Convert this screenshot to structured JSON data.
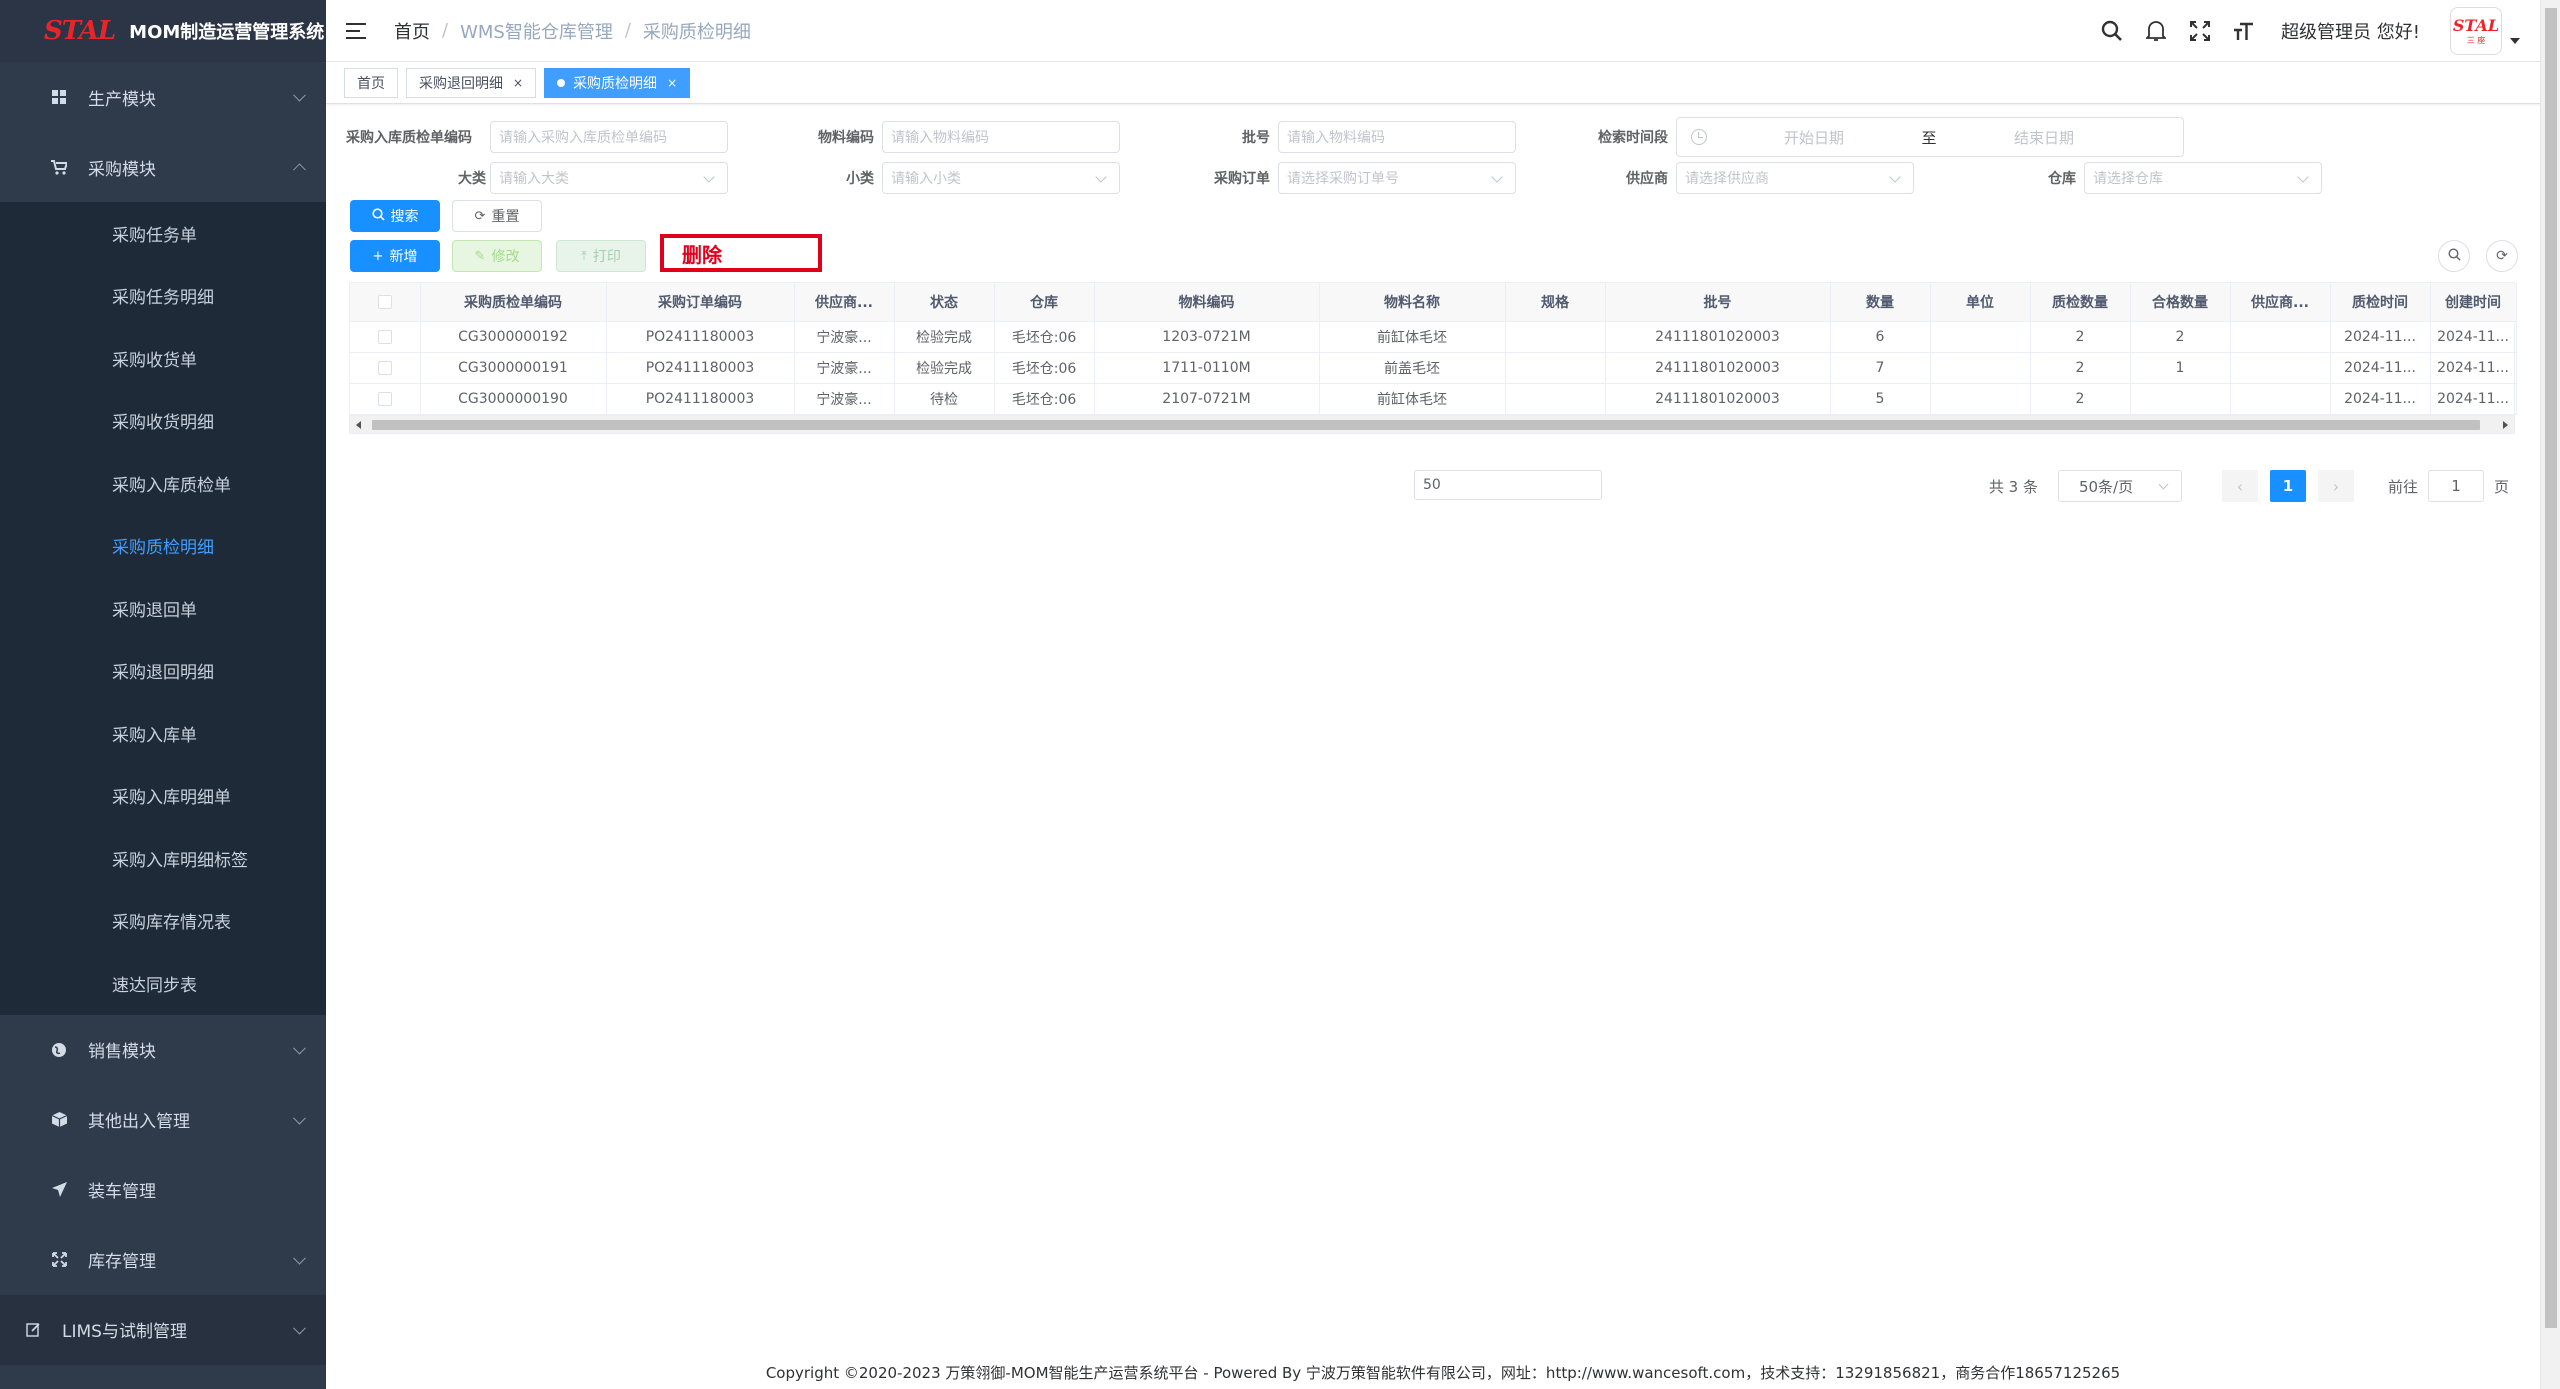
{
  "app": {
    "logo": "STAL",
    "title": "MOM制造运营管理系统"
  },
  "sidebar": {
    "items": [
      {
        "label": "生产模块",
        "icon": "grid-icon"
      },
      {
        "label": "采购模块",
        "icon": "cart-icon"
      },
      {
        "label": "销售模块",
        "icon": "globe-icon"
      },
      {
        "label": "其他出入管理",
        "icon": "box-icon"
      },
      {
        "label": "装车管理",
        "icon": "send-icon"
      },
      {
        "label": "库存管理",
        "icon": "expand-icon"
      },
      {
        "label": "LIMS与试制管理",
        "icon": "edit-icon"
      }
    ],
    "purchase_sub": [
      "采购任务单",
      "采购任务明细",
      "采购收货单",
      "采购收货明细",
      "采购入库质检单",
      "采购质检明细",
      "采购退回单",
      "采购退回明细",
      "采购入库单",
      "采购入库明细单",
      "采购入库明细标签",
      "采购库存情况表",
      "速达同步表"
    ]
  },
  "header": {
    "breadcrumb": [
      "首页",
      "WMS智能仓库管理",
      "采购质检明细"
    ],
    "greeting": "超级管理员 您好!",
    "avatar_top": "STAL",
    "avatar_bottom": "三 座"
  },
  "tags": [
    {
      "label": "首页"
    },
    {
      "label": "采购退回明细"
    },
    {
      "label": "采购质检明细"
    }
  ],
  "form": {
    "qc_code_label": "采购入库质检单编码",
    "qc_code_ph": "请输入采购入库质检单编码",
    "material_code_label": "物料编码",
    "material_code_ph": "请输入物料编码",
    "batch_label": "批号",
    "batch_ph": "请输入物料编码",
    "time_label": "检索时间段",
    "start_ph": "开始日期",
    "range_sep": "至",
    "end_ph": "结束日期",
    "category_label": "大类",
    "category_ph": "请输入大类",
    "subcategory_label": "小类",
    "subcategory_ph": "请输入小类",
    "po_label": "采购订单",
    "po_ph": "请选择采购订单号",
    "supplier_label": "供应商",
    "supplier_ph": "请选择供应商",
    "warehouse_label": "仓库",
    "warehouse_ph": "请选择仓库"
  },
  "buttons": {
    "search": "搜索",
    "reset": "重置",
    "add": "新增",
    "edit": "修改",
    "print": "打印",
    "delete": "删除"
  },
  "table": {
    "columns": [
      "",
      "采购质检单编码",
      "采购订单编码",
      "供应商...",
      "状态",
      "仓库",
      "物料编码",
      "物料名称",
      "规格",
      "批号",
      "数量",
      "单位",
      "质检数量",
      "合格数量",
      "供应商...",
      "质检时间",
      "创建时间"
    ],
    "rows": [
      [
        "",
        "CG3000000192",
        "PO2411180003",
        "宁波豪...",
        "检验完成",
        "毛坯仓:06",
        "1203-0721M",
        "前缸体毛坯",
        "",
        "24111801020003",
        "6",
        "",
        "2",
        "2",
        "",
        "2024-11...",
        "2024-11..."
      ],
      [
        "",
        "CG3000000191",
        "PO2411180003",
        "宁波豪...",
        "检验完成",
        "毛坯仓:06",
        "1711-0110M",
        "前盖毛坯",
        "",
        "24111801020003",
        "7",
        "",
        "2",
        "1",
        "",
        "2024-11...",
        "2024-11..."
      ],
      [
        "",
        "CG3000000190",
        "PO2411180003",
        "宁波豪...",
        "待检",
        "毛坯仓:06",
        "2107-0721M",
        "前缸体毛坯",
        "",
        "24111801020003",
        "5",
        "",
        "2",
        "",
        "",
        "2024-11...",
        "2024-11..."
      ]
    ]
  },
  "pagination": {
    "mid_input": "50",
    "total": "共 3 条",
    "page_size": "50条/页",
    "current": "1",
    "goto_prefix": "前往",
    "goto_value": "1",
    "goto_suffix": "页"
  },
  "footer": "Copyright ©2020-2023 万策翎御-MOM智能生产运营系统平台 - Powered By 宁波万策智能软件有限公司，网址：http://www.wancesoft.com，技术支持：13291856821，商务合作18657125265",
  "colors": {
    "sidebar_bg": "#2f3a4b",
    "primary": "#1890ff",
    "active_menu": "#409eff",
    "delete_red": "#e0001b"
  }
}
